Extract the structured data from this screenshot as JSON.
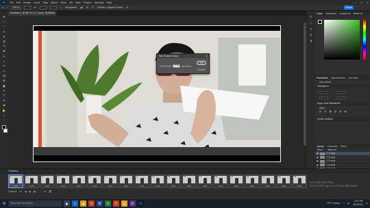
{
  "menubar": {
    "app_logo": "Ps",
    "items": [
      "File",
      "Edit",
      "Image",
      "Layer",
      "Type",
      "Select",
      "Filter",
      "3D",
      "View",
      "Plugins",
      "Window",
      "Help"
    ],
    "controls": [
      "—",
      "▢",
      "✕"
    ]
  },
  "options_bar": {
    "ratio": "Ratio",
    "delete_cropped": "Delete Cropped Pixels",
    "straighten": "Straighten",
    "share_label": "Share"
  },
  "document_tab": {
    "title": "Untitled-1 @ 66.7% (1 2.png, RGB/8#)"
  },
  "dialog": {
    "title": "Set Frame Delay",
    "field_label": "Set Delay:",
    "value": "0.05",
    "unit": "seconds",
    "ok_label": "OK",
    "cancel_label": "Cancel",
    "close_glyph": "✕"
  },
  "panels": {
    "color_tabs": [
      "Color",
      "Swatches",
      "Gradients",
      "Patterns"
    ],
    "properties_tabs": [
      "Properties",
      "Adjustments",
      "Libraries"
    ],
    "doc_label": "Document",
    "transform_label": "Transform",
    "align_label": "Align and Distribute",
    "align_sub": "Align:",
    "quick_actions_label": "Quick Actions",
    "layers_tabs": [
      "Layers",
      "Channels",
      "Paths"
    ],
    "layers_filter": "Kind",
    "layers_mode": "Normal",
    "layers": [
      "1 1.png",
      "1 2.png",
      "1 3.png",
      "1 4.png",
      "1 5.png",
      "1 6.png",
      "1 7.png"
    ]
  },
  "timeline": {
    "title": "Timeline",
    "frames": [
      {
        "n": "1",
        "d": "0.05"
      },
      {
        "n": "2",
        "d": "0.05"
      },
      {
        "n": "3",
        "d": "0.05"
      },
      {
        "n": "4",
        "d": "0.05"
      },
      {
        "n": "5",
        "d": "0.05"
      },
      {
        "n": "6",
        "d": "0.05"
      },
      {
        "n": "7",
        "d": "0.05"
      },
      {
        "n": "8",
        "d": "0.05"
      },
      {
        "n": "9",
        "d": "0.05"
      },
      {
        "n": "10",
        "d": "0.05"
      },
      {
        "n": "11",
        "d": "0.05"
      },
      {
        "n": "12",
        "d": "0.05"
      },
      {
        "n": "13",
        "d": "0.05"
      },
      {
        "n": "14",
        "d": "0.05"
      },
      {
        "n": "15",
        "d": "0.05"
      },
      {
        "n": "16",
        "d": "0.05"
      },
      {
        "n": "17",
        "d": "0.05"
      },
      {
        "n": "18",
        "d": "0.05"
      },
      {
        "n": "19",
        "d": "0.05"
      }
    ],
    "loop_label": "Forever"
  },
  "taskbar": {
    "search_placeholder": "Type here to search",
    "weather": "79°F Sunny",
    "time": "4:37 PM",
    "date": "8/1/2022"
  },
  "watermark": {
    "line1": "Activate Windows",
    "line2": "Go to Settings to activate Windows."
  },
  "colors": {
    "accent": "#1473e6",
    "ps_bg": "#001e36",
    "ps_fg": "#31a8ff",
    "selection": "#3d4f66"
  }
}
